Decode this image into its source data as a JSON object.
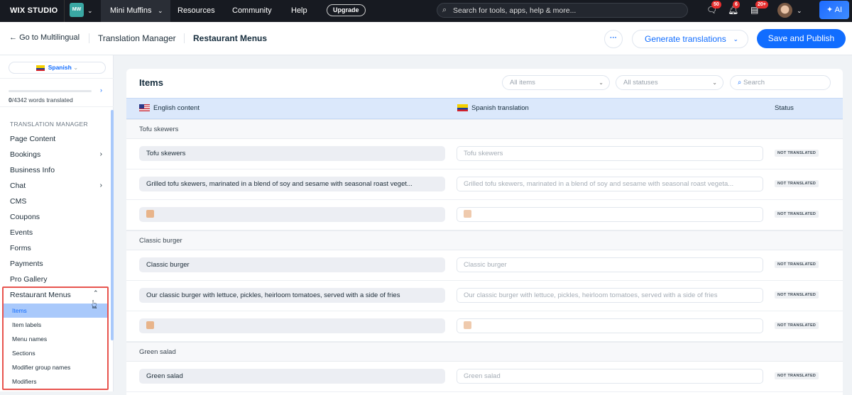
{
  "topbar": {
    "logo": "WIX STUDIO",
    "workspace_initials": "MW",
    "site_name": "Mini Muffins",
    "menus": [
      "Resources",
      "Community",
      "Help"
    ],
    "upgrade": "Upgrade",
    "search_placeholder": "Search for tools, apps, help & more...",
    "badges": {
      "messages": "50",
      "notifications": "6",
      "inbox": "20+"
    },
    "ai": "AI"
  },
  "header": {
    "back": "Go to Multilingual",
    "crumbs": [
      "Translation Manager",
      "Restaurant Menus"
    ],
    "more": "···",
    "generate": "Generate translations",
    "save": "Save and Publish"
  },
  "sidebar": {
    "language": "Spanish",
    "progress_count": "0",
    "progress_total": "/4342 words translated",
    "progress_fraction": 0,
    "section_title": "TRANSLATION MANAGER",
    "items": [
      {
        "label": "Page Content"
      },
      {
        "label": "Bookings",
        "chevron": true
      },
      {
        "label": "Business Info"
      },
      {
        "label": "Chat",
        "chevron": true
      },
      {
        "label": "CMS"
      },
      {
        "label": "Coupons"
      },
      {
        "label": "Events"
      },
      {
        "label": "Forms"
      },
      {
        "label": "Payments"
      },
      {
        "label": "Pro Gallery"
      },
      {
        "label": "Restaurant Menus",
        "expanded": true
      }
    ],
    "subitems": [
      "Items",
      "Item labels",
      "Menu names",
      "Sections",
      "Modifier group names",
      "Modifiers"
    ],
    "active_subitem": "Items"
  },
  "main": {
    "title": "Items",
    "filters": {
      "items": "All items",
      "statuses": "All statuses",
      "search_placeholder": "Search"
    },
    "columns": {
      "english": "English content",
      "spanish": "Spanish translation",
      "status": "Status"
    },
    "groups": [
      {
        "name": "Tofu skewers",
        "rows": [
          {
            "en": "Tofu skewers",
            "es": "Tofu skewers",
            "status": "NOT TRANSLATED"
          },
          {
            "en": "Grilled tofu skewers, marinated in a blend of soy and sesame with seasonal roast veget...",
            "es": "Grilled tofu skewers, marinated in a blend of soy and sesame with seasonal roast vegeta...",
            "status": "NOT TRANSLATED"
          },
          {
            "image": true,
            "en": "",
            "es": "",
            "status": "NOT TRANSLATED"
          }
        ]
      },
      {
        "name": "Classic burger",
        "rows": [
          {
            "en": "Classic burger",
            "es": "Classic burger",
            "status": "NOT TRANSLATED"
          },
          {
            "en": "Our classic burger with lettuce, pickles, heirloom tomatoes, served with a side of fries",
            "es": "Our classic burger with lettuce, pickles, heirloom tomatoes, served with a side of fries",
            "status": "NOT TRANSLATED"
          },
          {
            "image": true,
            "en": "",
            "es": "",
            "status": "NOT TRANSLATED"
          }
        ]
      },
      {
        "name": "Green salad",
        "rows": [
          {
            "en": "Green salad",
            "es": "Green salad",
            "status": "NOT TRANSLATED"
          }
        ]
      }
    ]
  },
  "colors": {
    "accent": "#116dff",
    "highlight": "#3b82f6",
    "active_bg": "#a9c9fb",
    "callout": "#e8544e"
  }
}
